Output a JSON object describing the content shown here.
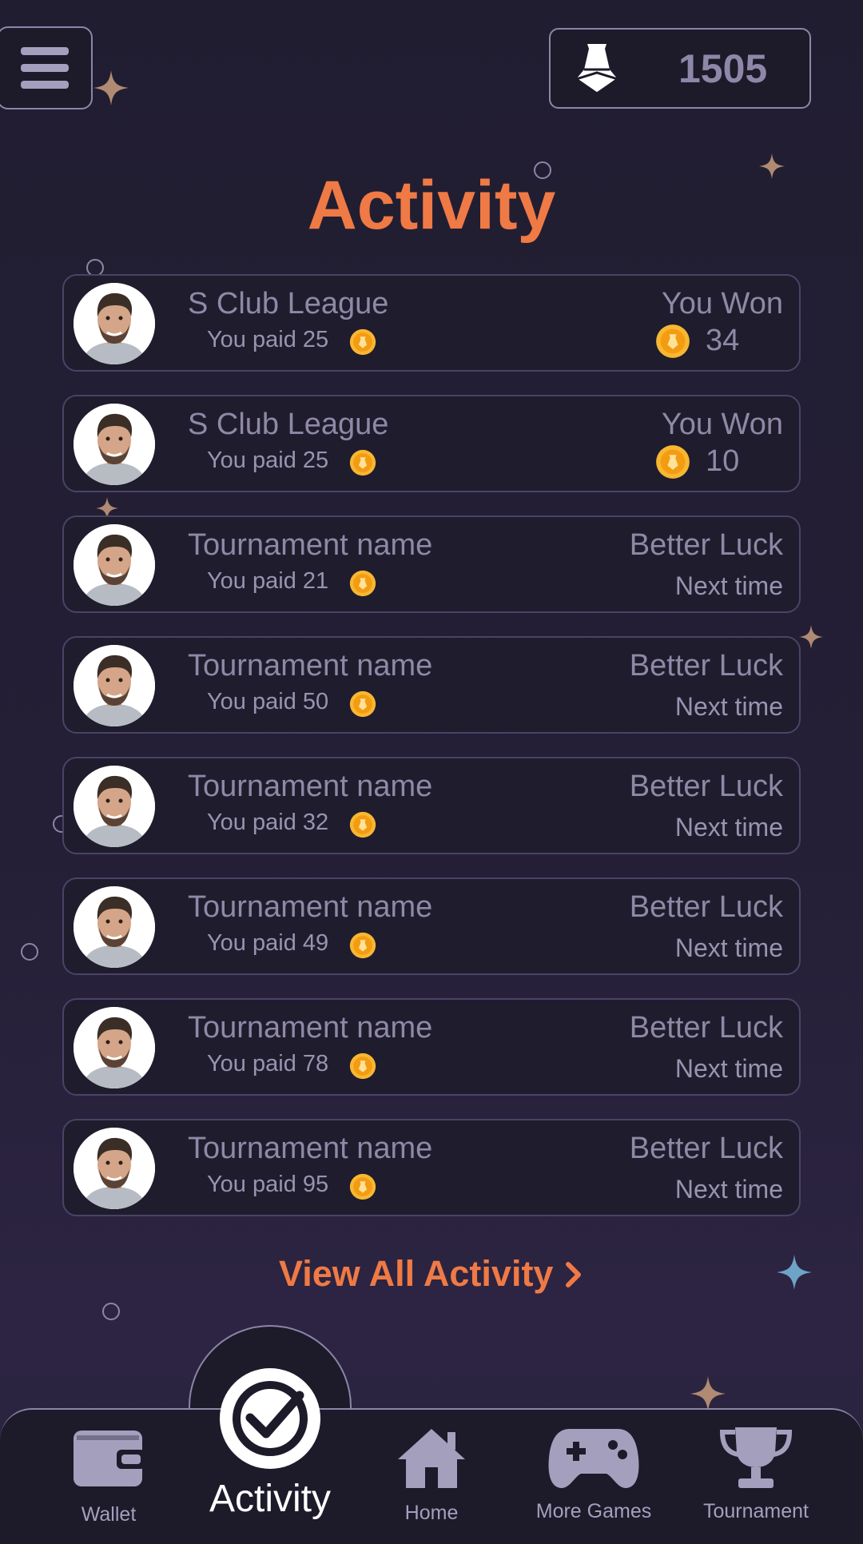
{
  "header": {
    "menu_icon": "hamburger-menu-icon",
    "coins": "1505",
    "coin_icon": "chess-pawn-icon"
  },
  "page_title": "Activity",
  "activities": [
    {
      "title": "S Club League",
      "paid": "You paid 25",
      "result_line1": "You Won",
      "won_amount": "34",
      "type": "won"
    },
    {
      "title": "S Club League",
      "paid": "You paid 25",
      "result_line1": "You Won",
      "won_amount": "10",
      "type": "won"
    },
    {
      "title": "Tournament name",
      "paid": "You paid 21",
      "result_line1": "Better Luck",
      "result_line2": "Next time",
      "type": "lost"
    },
    {
      "title": "Tournament name",
      "paid": "You paid 50",
      "result_line1": "Better Luck",
      "result_line2": "Next time",
      "type": "lost"
    },
    {
      "title": "Tournament name",
      "paid": "You paid 32",
      "result_line1": "Better Luck",
      "result_line2": "Next time",
      "type": "lost"
    },
    {
      "title": "Tournament name",
      "paid": "You paid 49",
      "result_line1": "Better Luck",
      "result_line2": "Next time",
      "type": "lost"
    },
    {
      "title": "Tournament name",
      "paid": "You paid 78",
      "result_line1": "Better Luck",
      "result_line2": "Next time",
      "type": "lost"
    },
    {
      "title": "Tournament name",
      "paid": "You paid 95",
      "result_line1": "Better Luck",
      "result_line2": "Next time",
      "type": "lost"
    }
  ],
  "view_all": "View All Activity",
  "nav": {
    "wallet": "Wallet",
    "activity": "Activity",
    "home": "Home",
    "more_games": "More Games",
    "tournament": "Tournament"
  },
  "colors": {
    "accent": "#ef7a45",
    "background": "#221e33",
    "coin": "#f5a623",
    "muted_text": "#8f88a6"
  }
}
